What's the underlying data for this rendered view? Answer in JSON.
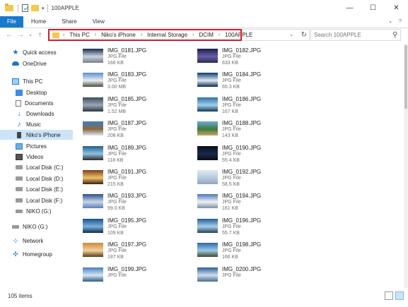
{
  "window": {
    "title": "100APPLE",
    "controls": {
      "minimize": "—",
      "maximize": "☐",
      "close": "✕"
    }
  },
  "ribbon": {
    "tabs": [
      "File",
      "Home",
      "Share",
      "View"
    ],
    "collapse_glyph": "⌄",
    "help_glyph": "?"
  },
  "navigation": {
    "back_glyph": "←",
    "forward_glyph": "→",
    "recent_glyph": "⌄",
    "up_glyph": "↑",
    "breadcrumb": [
      "This PC",
      "Niko's iPhone",
      "Internal Storage",
      "DCIM",
      "100APPLE"
    ],
    "crumb_separator": "›",
    "dropdown_glyph": "⌄",
    "refresh_glyph": "↻",
    "search_placeholder": "Search 100APPLE",
    "search_glyph": "⚲"
  },
  "sidebar": {
    "items": [
      {
        "label": "Quick access",
        "icon": "star-icon",
        "glyph": "★",
        "level": 0
      },
      {
        "label": "OneDrive",
        "icon": "cloud-icon",
        "glyph": "",
        "level": 0
      },
      {
        "label": "This PC",
        "icon": "computer-icon",
        "glyph": "",
        "level": 0
      },
      {
        "label": "Desktop",
        "icon": "desktop-icon",
        "glyph": "",
        "level": 1
      },
      {
        "label": "Documents",
        "icon": "documents-icon",
        "glyph": "",
        "level": 1
      },
      {
        "label": "Downloads",
        "icon": "download-icon",
        "glyph": "↓",
        "level": 1
      },
      {
        "label": "Music",
        "icon": "music-icon",
        "glyph": "♪",
        "level": 1
      },
      {
        "label": "Niko's iPhone",
        "icon": "phone-icon",
        "glyph": "",
        "level": 1,
        "selected": true
      },
      {
        "label": "Pictures",
        "icon": "pictures-icon",
        "glyph": "",
        "level": 1
      },
      {
        "label": "Videos",
        "icon": "videos-icon",
        "glyph": "",
        "level": 1
      },
      {
        "label": "Local Disk (C:)",
        "icon": "disk-icon",
        "glyph": "",
        "level": 1
      },
      {
        "label": "Local Disk (D:)",
        "icon": "disk-icon",
        "glyph": "",
        "level": 1
      },
      {
        "label": "Local Disk (E:)",
        "icon": "disk-icon",
        "glyph": "",
        "level": 1
      },
      {
        "label": "Local Disk (F:)",
        "icon": "disk-icon",
        "glyph": "",
        "level": 1
      },
      {
        "label": "NIKO (G:)",
        "icon": "usb-drive-icon",
        "glyph": "",
        "level": 1
      },
      {
        "label": "NIKO (G:)",
        "icon": "usb-drive-icon",
        "glyph": "",
        "level": 0
      },
      {
        "label": "Network",
        "icon": "network-icon",
        "glyph": "⊹",
        "level": 0
      },
      {
        "label": "Homegroup",
        "icon": "homegroup-icon",
        "glyph": "✣",
        "level": 0
      }
    ]
  },
  "files": [
    {
      "name": "IMG_0181.JPG",
      "type": "JPG File",
      "size": "166 KB",
      "thumb": [
        "#1c2b48",
        "#c8d4e6",
        "#7b7f86"
      ]
    },
    {
      "name": "IMG_0182.JPG",
      "type": "JPG File",
      "size": "633 KB",
      "thumb": [
        "#1a1c4a",
        "#6b5fa8",
        "#2c2a55"
      ]
    },
    {
      "name": "IMG_0183.JPG",
      "type": "JPG File",
      "size": "3.00 MB",
      "thumb": [
        "#5a8fc9",
        "#e9eef5",
        "#4a4f39"
      ]
    },
    {
      "name": "IMG_0184.JPG",
      "type": "JPG File",
      "size": "65.3 KB",
      "thumb": [
        "#0b3c6a",
        "#dfeaf5",
        "#0a2a4a"
      ]
    },
    {
      "name": "IMG_0185.JPG",
      "type": "JPG File",
      "size": "1.52 MB",
      "thumb": [
        "#3e4b5c",
        "#9aa8b6",
        "#2a3440"
      ]
    },
    {
      "name": "IMG_0186.JPG",
      "type": "JPG File",
      "size": "167 KB",
      "thumb": [
        "#2f6fa8",
        "#9fd0ea",
        "#12385a"
      ]
    },
    {
      "name": "IMG_0187.JPG",
      "type": "JPG File",
      "size": "208 KB",
      "thumb": [
        "#3a7bc8",
        "#8c6a3e",
        "#d8e6f2"
      ]
    },
    {
      "name": "IMG_0188.JPG",
      "type": "JPG File",
      "size": "143 KB",
      "thumb": [
        "#6fa9d8",
        "#3d7a3a",
        "#c9a567"
      ]
    },
    {
      "name": "IMG_0189.JPG",
      "type": "JPG File",
      "size": "118 KB",
      "thumb": [
        "#1e5d8f",
        "#8fc4e3",
        "#2f2a26"
      ]
    },
    {
      "name": "IMG_0190.JPG",
      "type": "JPG File",
      "size": "55.4 KB",
      "thumb": [
        "#0a0e1c",
        "#1b2a4a",
        "#090c14"
      ]
    },
    {
      "name": "IMG_0191.JPG",
      "type": "JPG File",
      "size": "215 KB",
      "thumb": [
        "#7a3f1a",
        "#f0c36a",
        "#3a1f10"
      ]
    },
    {
      "name": "IMG_0192.JPG",
      "type": "JPG File",
      "size": "58.5 KB",
      "thumb": [
        "#dfe8f2",
        "#b7c9dc",
        "#8fa6bf"
      ]
    },
    {
      "name": "IMG_0193.JPG",
      "type": "JPG File",
      "size": "99.0 KB",
      "thumb": [
        "#2b4f8c",
        "#c7d6ea",
        "#5a7fb3"
      ]
    },
    {
      "name": "IMG_0194.JPG",
      "type": "JPG File",
      "size": "161 KB",
      "thumb": [
        "#4a78b8",
        "#eef2f7",
        "#7d8fa3"
      ]
    },
    {
      "name": "IMG_0195.JPG",
      "type": "JPG File",
      "size": "109 KB",
      "thumb": [
        "#1a4f8a",
        "#7ab3de",
        "#0d2a4a"
      ]
    },
    {
      "name": "IMG_0196.JPG",
      "type": "JPG File",
      "size": "55.7 KB",
      "thumb": [
        "#1f5e9a",
        "#a9cfe8",
        "#24405c"
      ]
    },
    {
      "name": "IMG_0197.JPG",
      "type": "JPG File",
      "size": "187 KB",
      "thumb": [
        "#c98a3a",
        "#f3d29a",
        "#5a3a1a"
      ]
    },
    {
      "name": "IMG_0198.JPG",
      "type": "JPG File",
      "size": "166 KB",
      "thumb": [
        "#2a6aa8",
        "#9cc8e6",
        "#3d4a2a"
      ]
    },
    {
      "name": "IMG_0199.JPG",
      "type": "JPG File",
      "size": "",
      "thumb": [
        "#3f7fc0",
        "#d7e6f3",
        "#2f5a85"
      ]
    },
    {
      "name": "IMG_0200.JPG",
      "type": "JPG File",
      "size": "",
      "thumb": [
        "#2a5f9a",
        "#cfe0ef",
        "#4a6b8a"
      ]
    }
  ],
  "status": {
    "item_count": "105 items"
  },
  "colors": {
    "accent": "#1979ca",
    "highlight_box": "#d21f2a",
    "selection": "#cce4f7"
  }
}
